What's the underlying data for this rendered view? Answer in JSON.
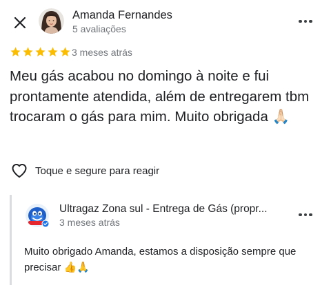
{
  "reviewer": {
    "name": "Amanda Fernandes",
    "reviews_count": "5 avaliações"
  },
  "review": {
    "rating": 5,
    "max_rating": 5,
    "star_color": "#fbbc04",
    "time": "3 meses atrás",
    "text": "Meu gás acabou no domingo à noite e fui prontamente atendida, além de entregarem tbm trocaram o gás para mim. Muito obrigada 🙏🏻"
  },
  "react": {
    "label": "Toque e segure para reagir",
    "icon": "heart-outline-icon"
  },
  "owner_reply": {
    "business_name": "Ultragaz Zona sul - Entrega de Gás (propr...",
    "time": "3 meses atrás",
    "text": "Muito obrigado Amanda, estamos a disposição sempre que precisar 👍🙏",
    "verified_badge_color": "#1a73e8"
  },
  "icons": {
    "close": "close-icon",
    "more": "more-vert-icon"
  }
}
